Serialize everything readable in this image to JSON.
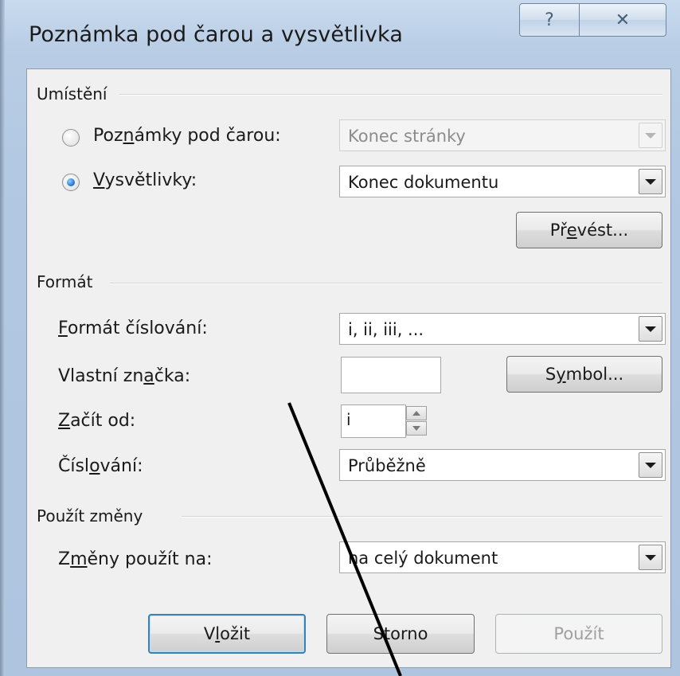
{
  "window": {
    "title": "Poznámka pod čarou a vysvětlivka",
    "help_glyph": "?",
    "close_glyph": "✕"
  },
  "location_group": {
    "label": "Umístění",
    "footnotes": {
      "label_pre": "Poz",
      "label_u": "n",
      "label_post": "ámky pod čarou:",
      "selected": false,
      "value": "Konec stránky",
      "enabled": false
    },
    "endnotes": {
      "label_pre": "",
      "label_u": "V",
      "label_post": "ysvětlivky:",
      "selected": true,
      "value": "Konec dokumentu",
      "enabled": true
    },
    "convert_button": {
      "pre": "Př",
      "u": "e",
      "post": "vést..."
    }
  },
  "format_group": {
    "label": "Formát",
    "number_format": {
      "label_u": "F",
      "label_post": "ormát číslování:",
      "value": "i, ii, iii, ..."
    },
    "custom_mark": {
      "label_pre": "Vlastní zn",
      "label_u": "a",
      "label_post": "čka:",
      "value": ""
    },
    "symbol_button": {
      "pre": "S",
      "u": "y",
      "post": "mbol..."
    },
    "start_at": {
      "label_u": "Z",
      "label_post": "ačít od:",
      "value": "i"
    },
    "numbering": {
      "label_pre": "Čísl",
      "label_u": "o",
      "label_post": "vání:",
      "value": "Průběžně"
    }
  },
  "apply_group": {
    "label": "Použít změny",
    "apply_to": {
      "label_pre": "Z",
      "label_u": "m",
      "label_post": "ěny použít na:",
      "value": "na celý dokument"
    }
  },
  "buttons": {
    "insert": {
      "pre": "V",
      "u": "l",
      "post": "ožit"
    },
    "cancel": "Storno",
    "apply": "Použít"
  }
}
